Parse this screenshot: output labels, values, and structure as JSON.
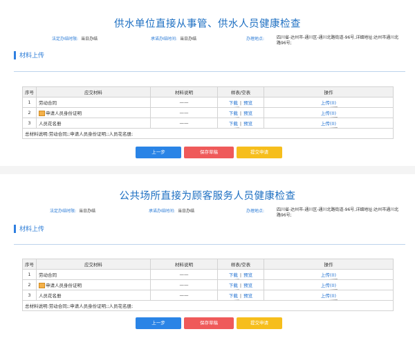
{
  "sections": [
    {
      "title": "供水单位直接从事管、供水人员健康检查",
      "meta": {
        "legal_label": "法定办结时限:",
        "legal_value": "当日办结",
        "promise_label": "承诺办结时间:",
        "promise_value": "当日办结",
        "place_label": "办理地点:",
        "place_value": "四川省-达州市-通川区-通川北路街道-96号,详细地址:达州市通川北路96号;"
      },
      "upload_heading": "材料上传",
      "table": {
        "headers": [
          "序号",
          "应交材料",
          "材料说明",
          "样表/空表",
          "操作"
        ],
        "rows": [
          {
            "no": "1",
            "name": "劳动合同",
            "desc": "——",
            "download": "下载",
            "preview": "预览",
            "upload": "上传(0)"
          },
          {
            "no": "2",
            "name": "申请人员身份证明",
            "desc": "——",
            "download": "下载",
            "preview": "预览",
            "upload": "上传(0)"
          },
          {
            "no": "3",
            "name": "人员花名册",
            "desc": "——",
            "download": "下载",
            "preview": "预览",
            "upload": "上传(0)"
          }
        ],
        "summary": "总材料说明:劳动合同;;申请人员身份证明;;人员花名册;"
      },
      "buttons": {
        "prev": "上一步",
        "save": "保存草稿",
        "submit": "提交申请"
      }
    },
    {
      "title": "公共场所直接为顾客服务人员健康检查",
      "meta": {
        "legal_label": "法定办结时限:",
        "legal_value": "当日办结",
        "promise_label": "承诺办结时间:",
        "promise_value": "当日办结",
        "place_label": "办理地点:",
        "place_value": "四川省-达州市-通川区-通川北路街道-96号,详细地址:达州市通川北路96号;"
      },
      "upload_heading": "材料上传",
      "table": {
        "headers": [
          "序号",
          "应交材料",
          "材料说明",
          "样表/空表",
          "操作"
        ],
        "rows": [
          {
            "no": "1",
            "name": "劳动合同",
            "desc": "——",
            "download": "下载",
            "preview": "预览",
            "upload": "上传(0)"
          },
          {
            "no": "2",
            "name": "申请人员身份证明",
            "desc": "——",
            "download": "下载",
            "preview": "预览",
            "upload": "上传(0)"
          },
          {
            "no": "3",
            "name": "人员花名册",
            "desc": "——",
            "download": "下载",
            "preview": "预览",
            "upload": "上传(0)"
          }
        ],
        "summary": "总材料说明:劳动合同;;申请人员身份证明;;人员花名册;"
      },
      "buttons": {
        "prev": "上一步",
        "save": "保存草稿",
        "submit": "提交申请"
      }
    }
  ],
  "colors": {
    "accent": "#1d6fc2",
    "prev": "#2a84e6",
    "save": "#ef5a5a",
    "submit": "#f6be1c"
  }
}
